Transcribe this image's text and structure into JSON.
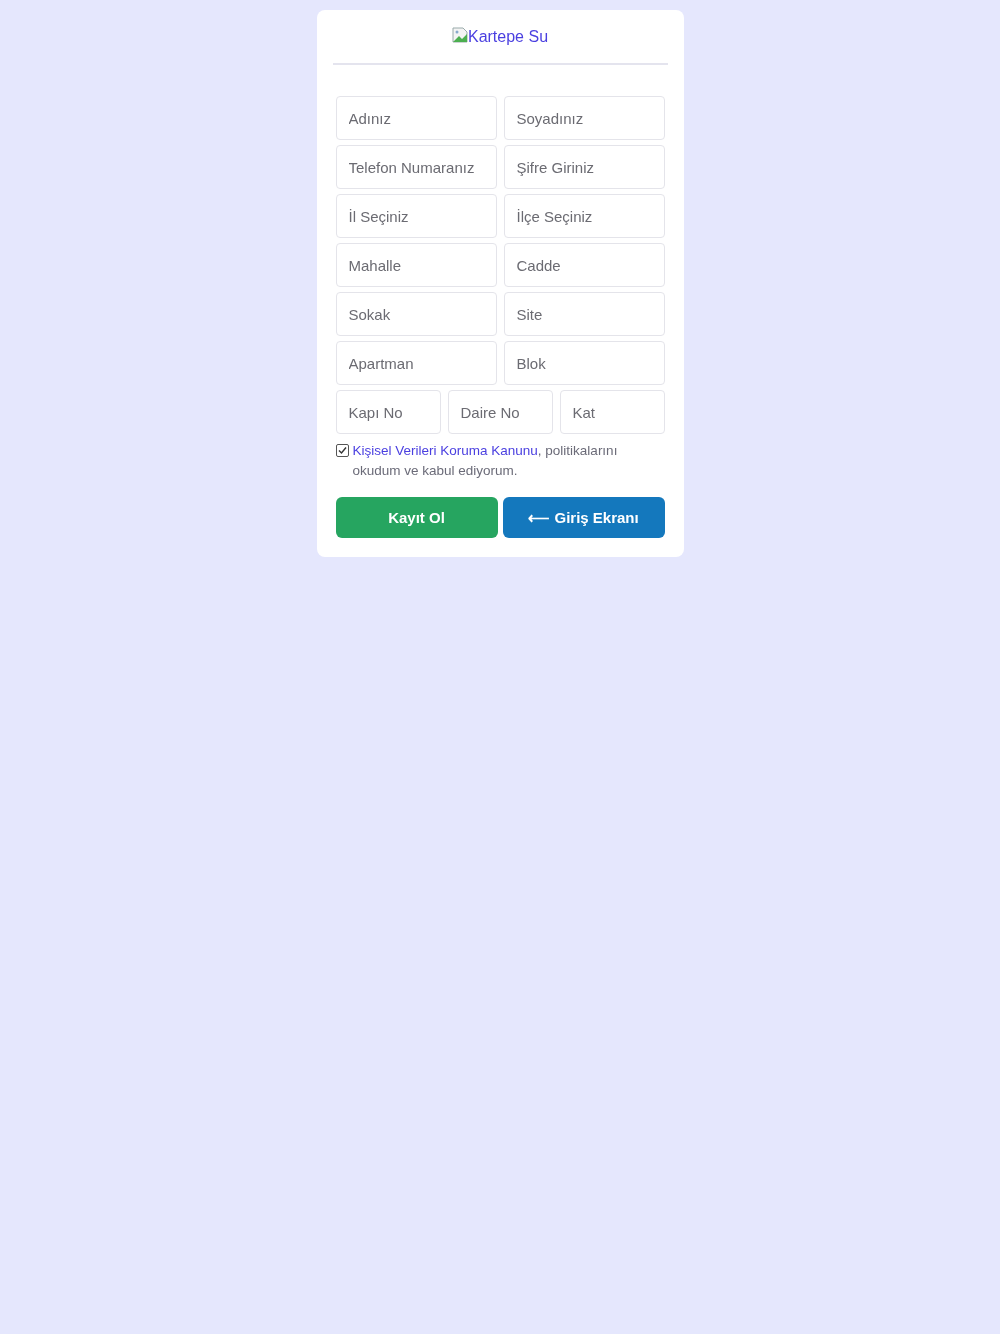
{
  "logo": {
    "alt_text": "Kartepe Su"
  },
  "field_rows": [
    {
      "fields": [
        {
          "placeholder": "Adınız"
        },
        {
          "placeholder": "Soyadınız"
        }
      ]
    },
    {
      "fields": [
        {
          "placeholder": "Telefon Numaranız"
        },
        {
          "placeholder": "Şifre Giriniz"
        }
      ]
    },
    {
      "fields": [
        {
          "placeholder": "İl Seçiniz"
        },
        {
          "placeholder": "İlçe Seçiniz"
        }
      ]
    },
    {
      "fields": [
        {
          "placeholder": "Mahalle"
        },
        {
          "placeholder": "Cadde"
        }
      ]
    },
    {
      "fields": [
        {
          "placeholder": "Sokak"
        },
        {
          "placeholder": "Site"
        }
      ]
    },
    {
      "fields": [
        {
          "placeholder": "Apartman"
        },
        {
          "placeholder": "Blok"
        }
      ]
    },
    {
      "fields": [
        {
          "placeholder": "Kapı No"
        },
        {
          "placeholder": "Daire No"
        },
        {
          "placeholder": "Kat"
        }
      ]
    }
  ],
  "consent": {
    "checked": true,
    "link": "Kişisel Verileri Koruma Kanunu",
    "text": ", politikalarını okudum ve kabul ediyorum."
  },
  "buttons": [
    {
      "kind": "primary",
      "label": "Kayıt Ol"
    },
    {
      "kind": "secondary",
      "label": "⟵ Giriş Ekranı"
    }
  ]
}
